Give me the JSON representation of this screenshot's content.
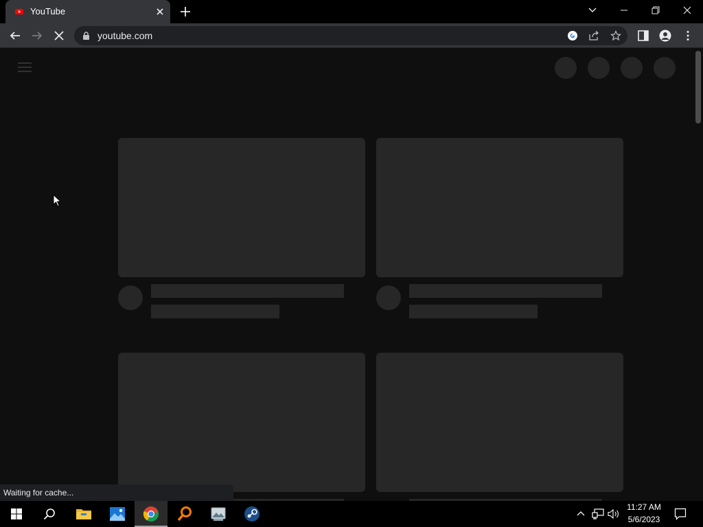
{
  "browser": {
    "tab": {
      "title": "YouTube",
      "favicon": "youtube-icon"
    },
    "address": {
      "url": "youtube.com"
    },
    "status_text": "Waiting for cache..."
  },
  "taskbar": {
    "apps": [
      "windows-start-icon",
      "search-icon",
      "file-explorer-icon",
      "photos-icon",
      "chrome-icon",
      "magnifier-app-icon",
      "photo-viewer-icon",
      "steam-icon"
    ],
    "active_app": "chrome-icon",
    "clock": {
      "time": "11:27 AM",
      "date": "5/6/2023"
    }
  },
  "colors": {
    "page_bg": "#0f0f0f",
    "placeholder": "#272727",
    "toolbar": "#35363a",
    "taskbar": "#000000"
  }
}
